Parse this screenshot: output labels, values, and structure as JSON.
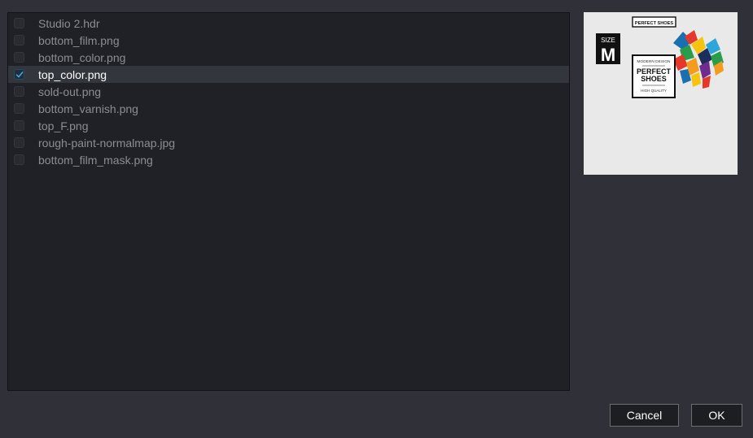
{
  "files": [
    {
      "name": "Studio 2.hdr",
      "checked": false
    },
    {
      "name": "bottom_film.png",
      "checked": false
    },
    {
      "name": "bottom_color.png",
      "checked": false
    },
    {
      "name": "top_color.png",
      "checked": true
    },
    {
      "name": "sold-out.png",
      "checked": false
    },
    {
      "name": "bottom_varnish.png",
      "checked": false
    },
    {
      "name": "top_F.png",
      "checked": false
    },
    {
      "name": "rough-paint-normalmap.jpg",
      "checked": false
    },
    {
      "name": "bottom_film_mask.png",
      "checked": false
    }
  ],
  "preview": {
    "brand_badge": "PERFECT SHOES",
    "size_label": "SIZE",
    "size_value": "M",
    "tagline": "MODERN DESIGN",
    "title_line1": "PERFECT",
    "title_line2": "SHOES",
    "subtitle": "HIGH QUALITY"
  },
  "buttons": {
    "cancel": "Cancel",
    "ok": "OK"
  }
}
